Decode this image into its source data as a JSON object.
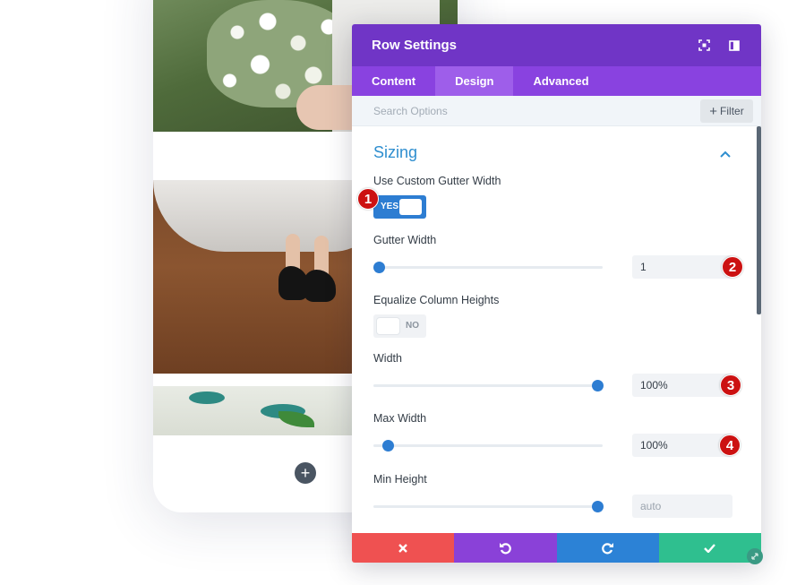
{
  "modal": {
    "title": "Row Settings",
    "header_icons": [
      "fullscreen-icon",
      "sidebar-layout-icon"
    ],
    "tabs": [
      {
        "label": "Content",
        "active": false
      },
      {
        "label": "Design",
        "active": true
      },
      {
        "label": "Advanced",
        "active": false
      }
    ],
    "search": {
      "placeholder": "Search Options",
      "value": ""
    },
    "filter_label": "Filter",
    "section": {
      "title": "Sizing",
      "expanded": true
    },
    "options": {
      "custom_gutter": {
        "label": "Use Custom Gutter Width",
        "state": "YES",
        "on": true
      },
      "gutter_width": {
        "label": "Gutter Width",
        "value": "1",
        "slider_fraction": 0.0
      },
      "equalize_heights": {
        "label": "Equalize Column Heights",
        "state": "NO",
        "on": false
      },
      "width": {
        "label": "Width",
        "value": "100%",
        "slider_fraction": 1.0
      },
      "max_width": {
        "label": "Max Width",
        "value": "100%",
        "slider_fraction": 0.04
      },
      "min_height": {
        "label": "Min Height",
        "value": "auto",
        "slider_fraction": 1.0
      }
    },
    "badges": [
      "1",
      "2",
      "3",
      "4"
    ],
    "footer_buttons": [
      "cancel-icon",
      "undo-icon",
      "redo-icon",
      "save-check-icon"
    ]
  },
  "colors": {
    "header": "#7035c6",
    "tabs": "#8942e0",
    "active_tab": "#9e5eea",
    "accent_blue": "#2d7dd2",
    "section_title": "#2e8ecf",
    "cancel": "#ef5151",
    "undo": "#8a41d8",
    "redo": "#2c82d6",
    "save": "#2fbf8f",
    "badge": "#cc1111"
  },
  "phone": {
    "add_label": "+"
  }
}
